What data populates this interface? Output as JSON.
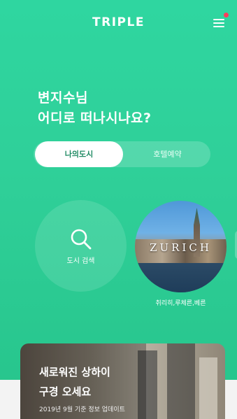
{
  "header": {
    "brand": "TRIPLE",
    "notification_dot_color": "#ff3b5c"
  },
  "greeting": {
    "line1": "변지수님",
    "line2": "어디로 떠나시나요?"
  },
  "tabs": [
    {
      "label": "나의도시",
      "active": true
    },
    {
      "label": "호텔예약",
      "active": false
    }
  ],
  "search": {
    "label": "도시 검색",
    "icon": "search-icon"
  },
  "city": {
    "photo_text": "ZURICH",
    "caption": "취리히,루체른,베른"
  },
  "promo": {
    "title_line1": "새로워진 상하이",
    "title_line2": "구경 오세요",
    "subtitle": "2019년 9월 기준 정보 업데이트"
  },
  "colors": {
    "brand_green": "#2fd6a0",
    "active_tab_text": "#1f8a63"
  }
}
